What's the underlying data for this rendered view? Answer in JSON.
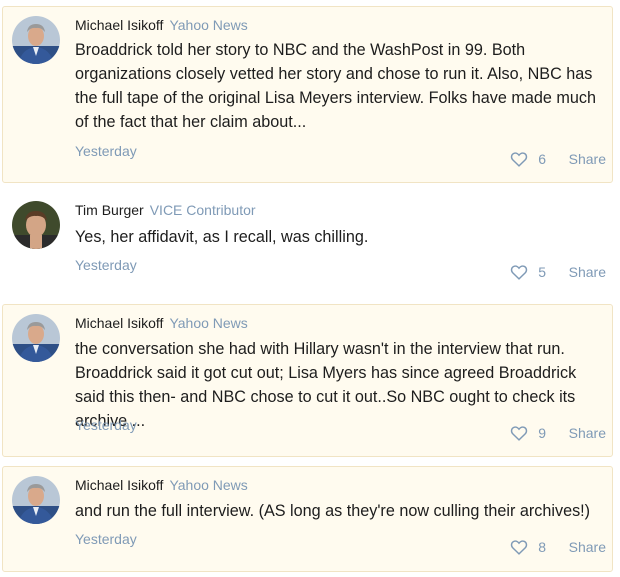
{
  "comments": [
    {
      "author": "Michael Isikoff",
      "role": "Yahoo News",
      "text": "Broaddrick told her story to NBC and the WashPost in 99. Both organizations closely vetted her story and chose to run it. Also, NBC has the full tape of the original Lisa Meyers interview. Folks have made much of the fact that her claim about...",
      "time": "Yesterday",
      "likes": "6",
      "share_label": "Share",
      "avatar_icon": "avatar-michael-isikoff",
      "like_icon": "heart-icon"
    },
    {
      "author": "Tim Burger",
      "role": "VICE Contributor",
      "text": "Yes, her affidavit, as I recall, was chilling.",
      "time": "Yesterday",
      "likes": "5",
      "share_label": "Share",
      "avatar_icon": "avatar-tim-burger",
      "like_icon": "heart-icon"
    },
    {
      "author": "Michael Isikoff",
      "role": "Yahoo News",
      "text": "the conversation she had with Hillary wasn't in the interview that run. Broaddrick said it got cut out; Lisa Myers has since agreed Broaddrick said this then- and NBC chose to cut it out..So NBC ought to check its archive ...",
      "time": "Yesterday",
      "likes": "9",
      "share_label": "Share",
      "avatar_icon": "avatar-michael-isikoff",
      "like_icon": "heart-icon"
    },
    {
      "author": "Michael Isikoff",
      "role": "Yahoo News",
      "text": "and run the full interview. (AS long as they're now culling their archives!)",
      "time": "Yesterday",
      "likes": "8",
      "share_label": "Share",
      "avatar_icon": "avatar-michael-isikoff",
      "like_icon": "heart-icon"
    }
  ],
  "colors": {
    "highlight_bg": "#fffbef",
    "highlight_border": "#f1e4c4",
    "meta_text": "#7f9ab6",
    "body_text": "#1d1d1d"
  }
}
